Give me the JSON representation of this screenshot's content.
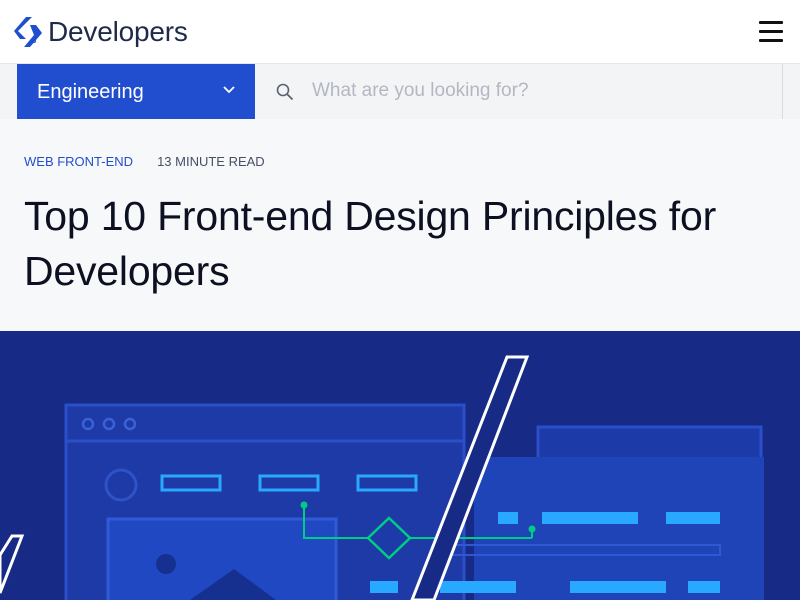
{
  "header": {
    "brand_name": "Developers",
    "logo_icon": "toptal-logo-icon",
    "menu_icon": "hamburger-menu-icon"
  },
  "filter": {
    "category_selected": "Engineering",
    "search_placeholder": "What are you looking for?"
  },
  "article": {
    "category": "WEB FRONT-END",
    "read_time": "13 MINUTE READ",
    "title": "Top 10 Front-end Design Principles for Developers"
  },
  "colors": {
    "accent_blue": "#204ecf",
    "hero_background": "#162a86",
    "hero_green": "#00cc83",
    "hero_cyan": "#29a8ff"
  }
}
